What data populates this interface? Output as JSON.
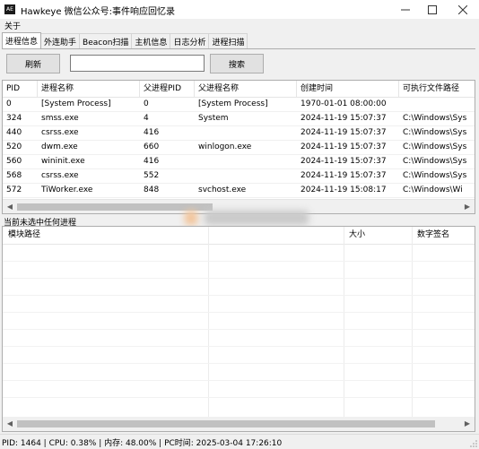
{
  "window": {
    "title": "Hawkeye 微信公众号:事件响应回忆录",
    "icon_text": "AE",
    "controls": [
      "minimize-icon",
      "maximize-icon",
      "close-icon"
    ]
  },
  "menubar": {
    "items": [
      "关于"
    ]
  },
  "tabs": [
    {
      "label": "进程信息",
      "active": true
    },
    {
      "label": "外连助手",
      "active": false
    },
    {
      "label": "Beacon扫描",
      "active": false
    },
    {
      "label": "主机信息",
      "active": false
    },
    {
      "label": "日志分析",
      "active": false
    },
    {
      "label": "进程扫描",
      "active": false
    }
  ],
  "toolbar": {
    "refresh_label": "刷新",
    "search_value": "",
    "search_label": "搜索"
  },
  "process_table": {
    "columns": [
      "PID",
      "进程名称",
      "父进程PID",
      "父进程名称",
      "创建时间",
      "可执行文件路径"
    ],
    "rows": [
      [
        "0",
        "[System Process]",
        "0",
        "[System Process]",
        "1970-01-01 08:00:00",
        ""
      ],
      [
        "324",
        "smss.exe",
        "4",
        "System",
        "2024-11-19 15:07:37",
        "C:\\Windows\\Sys"
      ],
      [
        "440",
        "csrss.exe",
        "416",
        "",
        "2024-11-19 15:07:37",
        "C:\\Windows\\Sys"
      ],
      [
        "520",
        "dwm.exe",
        "660",
        "winlogon.exe",
        "2024-11-19 15:07:37",
        "C:\\Windows\\Sys"
      ],
      [
        "560",
        "wininit.exe",
        "416",
        "",
        "2024-11-19 15:07:37",
        "C:\\Windows\\Sys"
      ],
      [
        "568",
        "csrss.exe",
        "552",
        "",
        "2024-11-19 15:07:37",
        "C:\\Windows\\Sys"
      ],
      [
        "572",
        "TiWorker.exe",
        "848",
        "svchost.exe",
        "2024-11-19 15:08:17",
        "C:\\Windows\\Wi"
      ]
    ]
  },
  "selection_status": "当前未选中任何进程",
  "module_table": {
    "columns": [
      "模块路径",
      "大小",
      "数字签名"
    ],
    "rows": []
  },
  "statusbar": {
    "text": "PID: 1464 | CPU: 0.38% | 内存: 48.00% | PC时间: 2025-03-04 17:26:10"
  },
  "colors": {
    "window_bg": "#f0f0f0",
    "panel_border": "#adadad",
    "button_bg": "#e1e1e1",
    "scroll_thumb": "#c1c1c1"
  }
}
